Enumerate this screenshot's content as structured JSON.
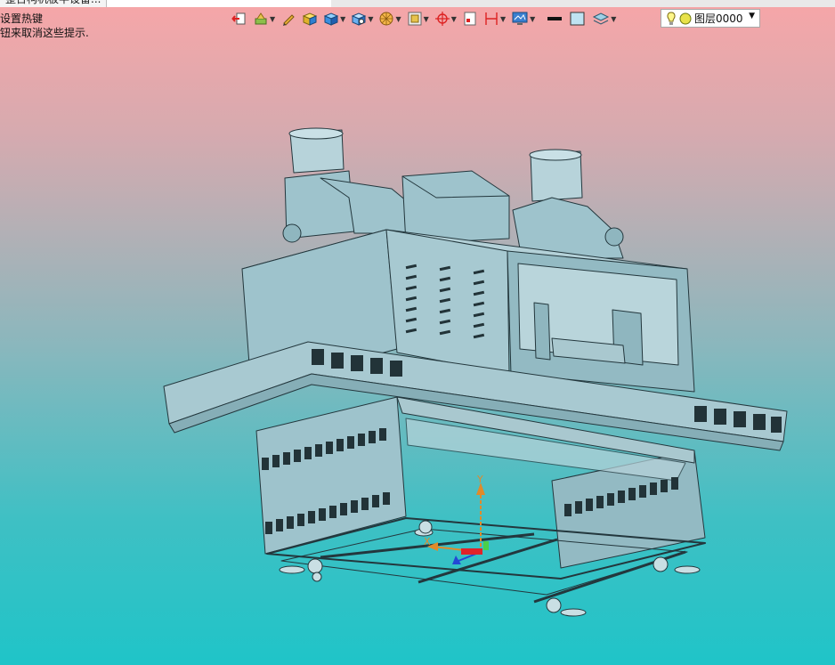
{
  "window": {
    "title_partial": "整台构机板半设备..."
  },
  "hints": {
    "line1": "设置热键",
    "line2": "钮来取消这些提示."
  },
  "toolbar": {
    "items": [
      {
        "name": "exit-icon",
        "dropdown": false
      },
      {
        "name": "render-mode-icon",
        "dropdown": true
      },
      {
        "name": "pen-icon",
        "dropdown": false
      },
      {
        "name": "box-yellow-icon",
        "dropdown": false
      },
      {
        "name": "box-blue-icon",
        "dropdown": true
      },
      {
        "name": "box-view-icon",
        "dropdown": true
      },
      {
        "name": "pizza-icon",
        "dropdown": true
      },
      {
        "name": "frame-icon",
        "dropdown": true
      },
      {
        "name": "crosshair-icon",
        "dropdown": true
      },
      {
        "name": "page-icon",
        "dropdown": false
      },
      {
        "name": "dimension-icon",
        "dropdown": true
      },
      {
        "name": "display-icon",
        "dropdown": true
      }
    ],
    "line_color": "#111111",
    "fill_color": "#bfe3f2"
  },
  "layer": {
    "label": "图层0000"
  },
  "colors": {
    "model_fill": "#9ec3cc",
    "model_line": "#23373d",
    "bg_top": "#f7a6a8",
    "bg_bottom": "#1fc4c8",
    "axis_y": "#e08a2a",
    "axis_x": "#e0232a",
    "axis_z": "#2348d6"
  },
  "axis": {
    "y_label": "Y",
    "x_label": "X"
  }
}
